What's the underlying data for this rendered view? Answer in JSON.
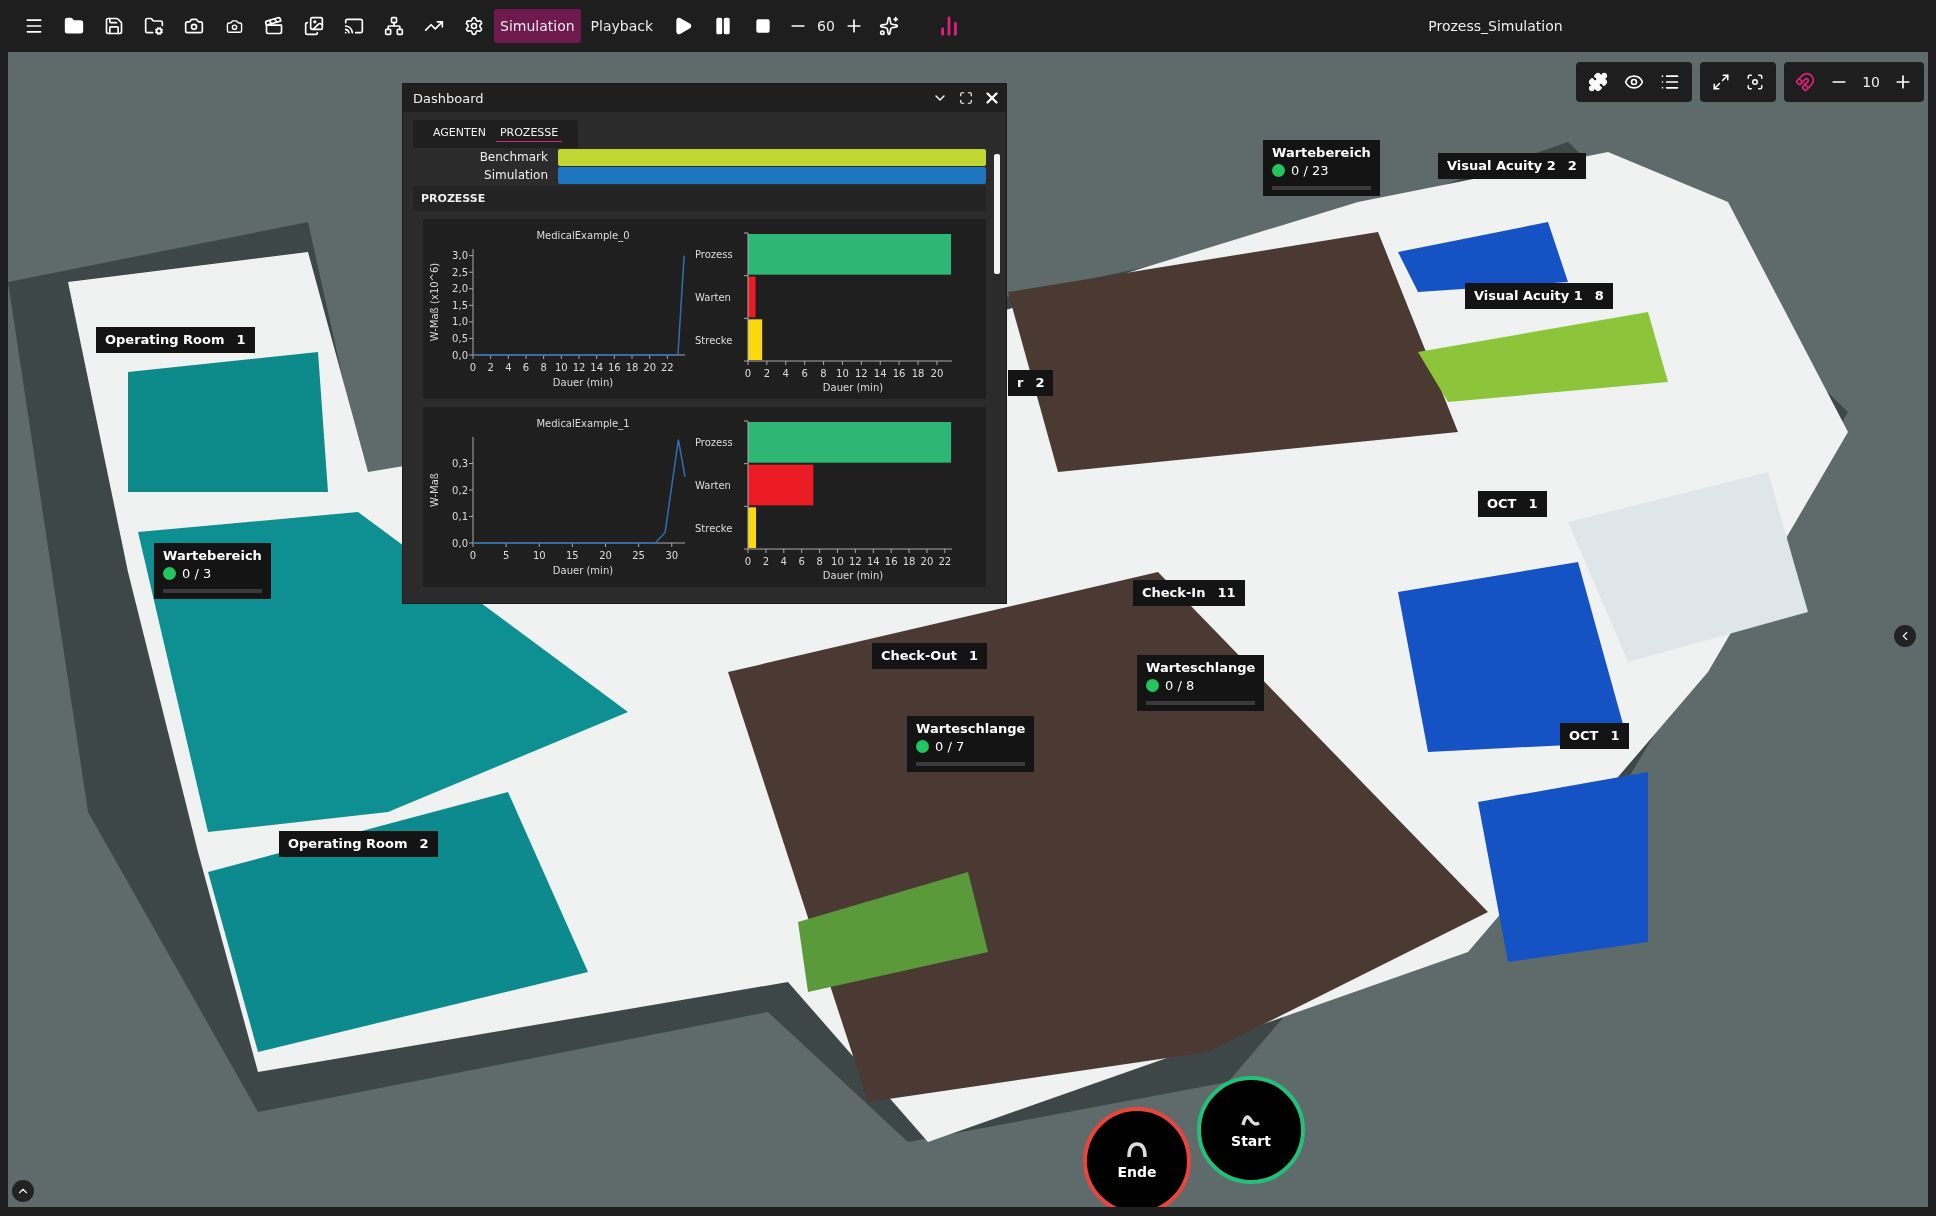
{
  "toolbar": {
    "tabs": [
      {
        "label": "Simulation",
        "selected": true
      },
      {
        "label": "Playback",
        "selected": false
      }
    ],
    "speed": "60"
  },
  "title": "Prozess_Simulation",
  "view_controls": {
    "zoom": "10"
  },
  "dashboard": {
    "title": "Dashboard",
    "tabs": [
      {
        "label": "AGENTEN",
        "selected": false
      },
      {
        "label": "PROZESSE",
        "selected": true
      }
    ],
    "legend": [
      {
        "label": "Benchmark",
        "color": "#c0d732"
      },
      {
        "label": "Simulation",
        "color": "#1e76c0"
      }
    ],
    "section": "PROZESSE",
    "processes": [
      {
        "trend": {
          "chart_data": {
            "type": "line",
            "title": "MedicalExample_0",
            "xlabel": "Dauer (min)",
            "ylabel": "W-Maß (x10^6)",
            "x": [
              0,
              23.2,
              23.9
            ],
            "series": [
              {
                "color": "#2f6fb0",
                "values": [
                  0,
                  0,
                  3.0
                ]
              }
            ],
            "xlim": [
              0,
              24
            ],
            "ylim": [
              0,
              3.2
            ],
            "xticks": [
              0,
              2,
              4,
              6,
              8,
              10,
              12,
              14,
              16,
              18,
              20,
              22
            ],
            "yticks": [
              {
                "value": 0,
                "label": "0,0"
              },
              {
                "value": 0.5,
                "label": "0,5"
              },
              {
                "value": 1,
                "label": "1,0"
              },
              {
                "value": 1.5,
                "label": "1,5"
              },
              {
                "value": 2,
                "label": "2,0"
              },
              {
                "value": 2.5,
                "label": "2,5"
              },
              {
                "value": 3,
                "label": "3,0"
              }
            ]
          }
        },
        "durations": {
          "chart_data": {
            "type": "bar",
            "orientation": "horizontal",
            "stacked": true,
            "xlabel": "Dauer (min)",
            "series": [
              {
                "name": "Prozess",
                "color": "#2db674",
                "values": [
                  21.5,
                  null,
                  null
                ]
              },
              {
                "name": "Warten",
                "color": "#ec1c24",
                "values": [
                  null,
                  0.8,
                  null
                ]
              },
              {
                "name": "Strecke",
                "color": "#fcd80e",
                "values": [
                  null,
                  null,
                  1.5
                ]
              }
            ],
            "xlim": [
              0,
              21.6
            ],
            "xticks": [
              0,
              2,
              4,
              6,
              8,
              10,
              12,
              14,
              16,
              18,
              20
            ]
          }
        }
      },
      {
        "trend": {
          "chart_data": {
            "type": "line",
            "title": "MedicalExample_1",
            "xlabel": "Dauer (min)",
            "ylabel": "W-Maß",
            "x": [
              0,
              27.5,
              29,
              31,
              32
            ],
            "series": [
              {
                "color": "#2f6fb0",
                "values": [
                  0,
                  0,
                  0.04,
                  0.39,
                  0.25
                ]
              }
            ],
            "xlim": [
              0,
              32
            ],
            "ylim": [
              0,
              0.4
            ],
            "xticks": [
              0,
              5,
              10,
              15,
              20,
              25,
              30
            ],
            "yticks": [
              {
                "value": 0,
                "label": "0,0"
              },
              {
                "value": 0.1,
                "label": "0,1"
              },
              {
                "value": 0.2,
                "label": "0,2"
              },
              {
                "value": 0.3,
                "label": "0,3"
              }
            ]
          }
        },
        "durations": {
          "chart_data": {
            "type": "bar",
            "orientation": "horizontal",
            "stacked": true,
            "xlabel": "Dauer (min)",
            "series": [
              {
                "name": "Prozess",
                "color": "#2db674",
                "values": [
                  22.7,
                  null,
                  null
                ]
              },
              {
                "name": "Warten",
                "color": "#ec1c24",
                "values": [
                  null,
                  7.3,
                  null
                ]
              },
              {
                "name": "Strecke",
                "color": "#fcd80e",
                "values": [
                  null,
                  null,
                  0.9
                ]
              }
            ],
            "xlim": [
              0,
              22.8
            ],
            "xticks": [
              0,
              2,
              4,
              6,
              8,
              10,
              12,
              14,
              16,
              18,
              20,
              22
            ]
          }
        }
      }
    ]
  },
  "markers": [
    {
      "kind": "room",
      "name": "Operating Room",
      "count": "1"
    },
    {
      "kind": "queue",
      "name": "Wartebereich",
      "occupancy": "0 / 3"
    },
    {
      "kind": "room",
      "name": "Operating Room",
      "count": "2"
    },
    {
      "kind": "queue",
      "name": "Wartebereich",
      "occupancy": "0 / 23"
    },
    {
      "kind": "room",
      "name": "Visual Acuity 2",
      "count": "2"
    },
    {
      "kind": "room",
      "name": "Visual Acuity 1",
      "count": "8"
    },
    {
      "kind": "room",
      "name": "r",
      "count": "2"
    },
    {
      "kind": "room",
      "name": "OCT",
      "count": "1"
    },
    {
      "kind": "room",
      "name": "Check-In",
      "count": "11"
    },
    {
      "kind": "room",
      "name": "Check-Out",
      "count": "1"
    },
    {
      "kind": "queue",
      "name": "Warteschlange",
      "occupancy": "0 / 8"
    },
    {
      "kind": "queue",
      "name": "Warteschlange",
      "occupancy": "0 / 7"
    },
    {
      "kind": "room",
      "name": "OCT",
      "count": "1"
    }
  ],
  "sim_buttons": [
    {
      "kind": "end",
      "label": "Ende"
    },
    {
      "kind": "start",
      "label": "Start"
    }
  ]
}
